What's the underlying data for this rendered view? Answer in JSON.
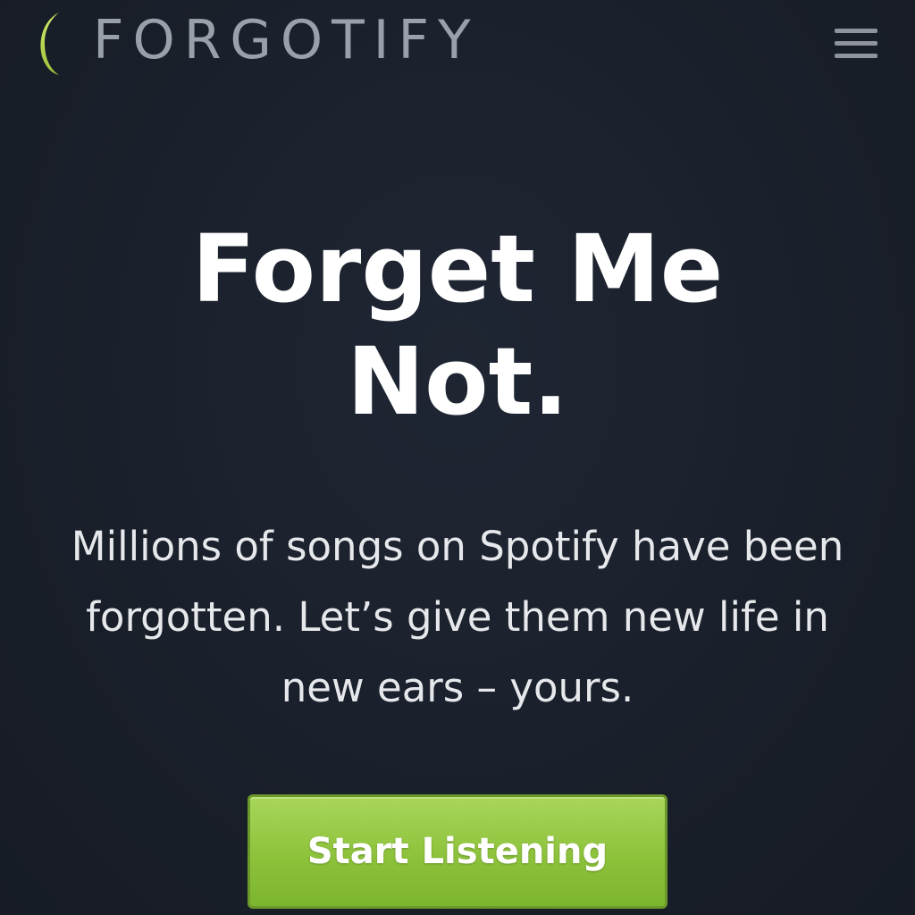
{
  "header": {
    "logo_icon": "crescent-moon-icon",
    "logo_text": "FORGOTIFY",
    "menu_icon": "hamburger-menu-icon"
  },
  "hero": {
    "title_lines": [
      "Forget Me",
      "Not."
    ],
    "description_lines": [
      "Millions of songs on Spotify have been",
      "forgotten. Let’s give them new life in",
      "new ears – yours."
    ],
    "cta_label": "Start Listening"
  },
  "colors": {
    "background": "#1a202b",
    "logo_accent": "#b7d64a",
    "logo_text": "#9aa0aa",
    "cta_green": "#8dc23b",
    "title": "#ffffff"
  }
}
